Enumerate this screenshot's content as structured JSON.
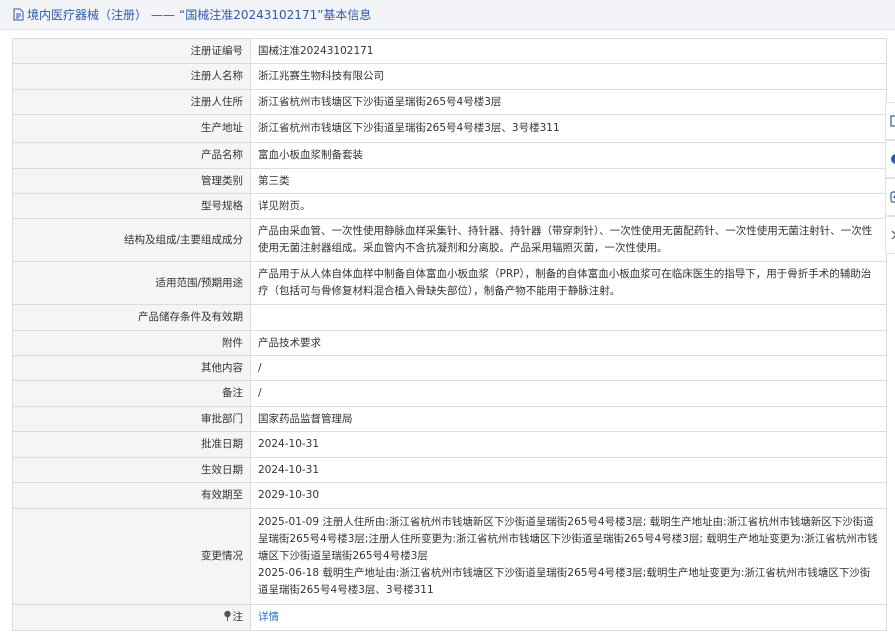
{
  "header": {
    "category": "境内医疗器械（注册）",
    "separator": "——",
    "title": "“国械注准20243102171”基本信息"
  },
  "rows": [
    {
      "label": "注册证编号",
      "value": "国械注准20243102171"
    },
    {
      "label": "注册人名称",
      "value": "浙江兆赛生物科技有限公司"
    },
    {
      "label": "注册人住所",
      "value": "浙江省杭州市钱塘区下沙街道呈瑞街265号4号楼3层"
    },
    {
      "label": "生产地址",
      "value": "浙江省杭州市钱塘区下沙街道呈瑞街265号4号楼3层、3号楼311"
    },
    {
      "label": "产品名称",
      "value": "富血小板血浆制备套装"
    },
    {
      "label": "管理类别",
      "value": "第三类"
    },
    {
      "label": "型号规格",
      "value": "详见附页。"
    },
    {
      "label": "结构及组成/主要组成成分",
      "value": "产品由采血管、一次性使用静脉血样采集针、持针器、持针器（带穿刺针）、一次性使用无菌配药针、一次性使用无菌注射针、一次性使用无菌注射器组成。采血管内不含抗凝剂和分离胶。产品采用辐照灭菌，一次性使用。"
    },
    {
      "label": "适用范围/预期用途",
      "value": "产品用于从人体自体血样中制备自体富血小板血浆（PRP），制备的自体富血小板血浆可在临床医生的指导下，用于骨折手术的辅助治疗（包括可与骨修复材料混合植入骨缺失部位），制备产物不能用于静脉注射。"
    },
    {
      "label": "产品储存条件及有效期",
      "value": ""
    },
    {
      "label": "附件",
      "value": "产品技术要求"
    },
    {
      "label": "其他内容",
      "value": "/"
    },
    {
      "label": "备注",
      "value": "/"
    },
    {
      "label": "审批部门",
      "value": "国家药品监督管理局"
    },
    {
      "label": "批准日期",
      "value": "2024-10-31"
    },
    {
      "label": "生效日期",
      "value": "2024-10-31"
    },
    {
      "label": "有效期至",
      "value": "2029-10-30"
    },
    {
      "label": "变更情况",
      "value": "2025-01-09 注册人住所由:浙江省杭州市钱塘新区下沙街道呈瑞街265号4号楼3层; 载明生产地址由:浙江省杭州市钱塘新区下沙街道呈瑞街265号4号楼3层;注册人住所变更为:浙江省杭州市钱塘区下沙街道呈瑞街265号4号楼3层; 载明生产地址变更为:浙江省杭州市钱塘区下沙街道呈瑞街265号4号楼3层",
      "value2": "2025-06-18 载明生产地址由:浙江省杭州市钱塘区下沙街道呈瑞街265号4号楼3层;载明生产地址变更为:浙江省杭州市钱塘区下沙街道呈瑞街265号4号楼3层、3号楼311"
    }
  ],
  "note_row": {
    "label": "注",
    "link_text": "详情"
  },
  "icons": {
    "header": "document-icon",
    "note": "pin-icon",
    "side": [
      "checkbox-icon",
      "circle-icon",
      "device-icon",
      "chevron-right-icon"
    ]
  },
  "colors": {
    "header_text": "#2f5aa8",
    "link": "#2f73c8",
    "label_bg": "#f5f5f5",
    "header_bg": "#f3f4f8"
  }
}
